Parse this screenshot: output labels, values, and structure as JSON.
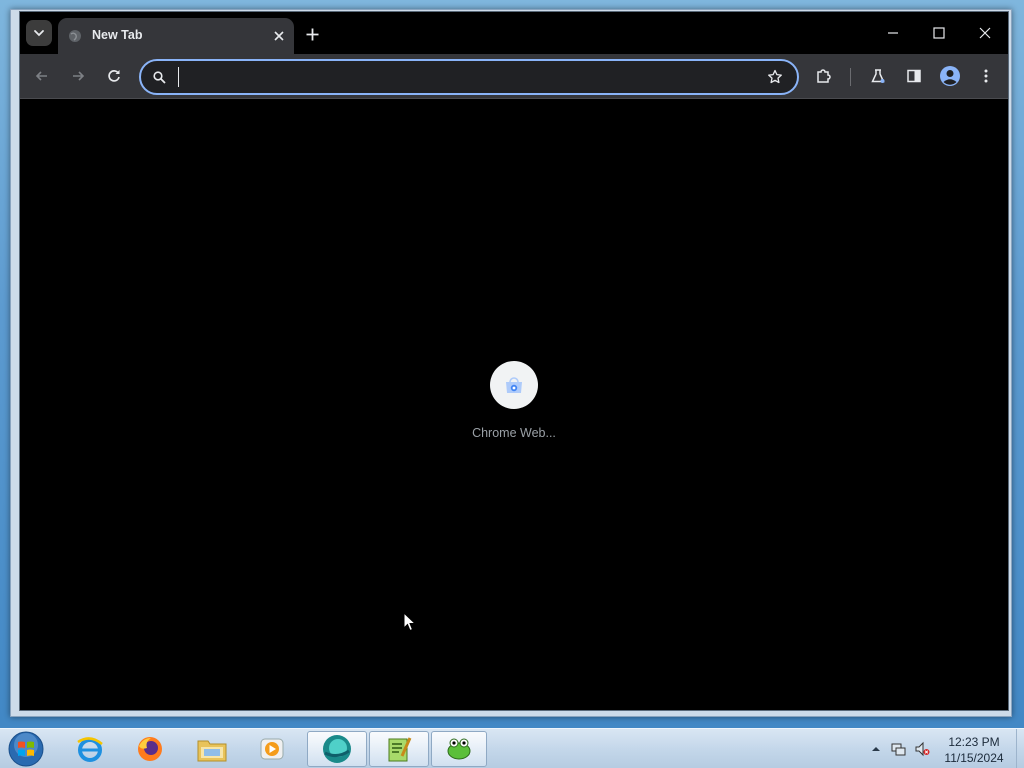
{
  "window": {
    "tab_title": "New Tab"
  },
  "omnibox": {
    "value": "",
    "placeholder": ""
  },
  "shortcuts": [
    {
      "label": "Chrome Web..."
    }
  ],
  "taskbar": {
    "clock_time": "12:23 PM",
    "clock_date": "11/15/2024",
    "pinned": [
      "internet-explorer",
      "firefox",
      "file-explorer",
      "media-player",
      "browser",
      "text-editor",
      "game"
    ]
  },
  "colors": {
    "chrome_dark": "#35363a",
    "omnibox_focus": "#8ab4f8",
    "page_bg": "#000000"
  }
}
